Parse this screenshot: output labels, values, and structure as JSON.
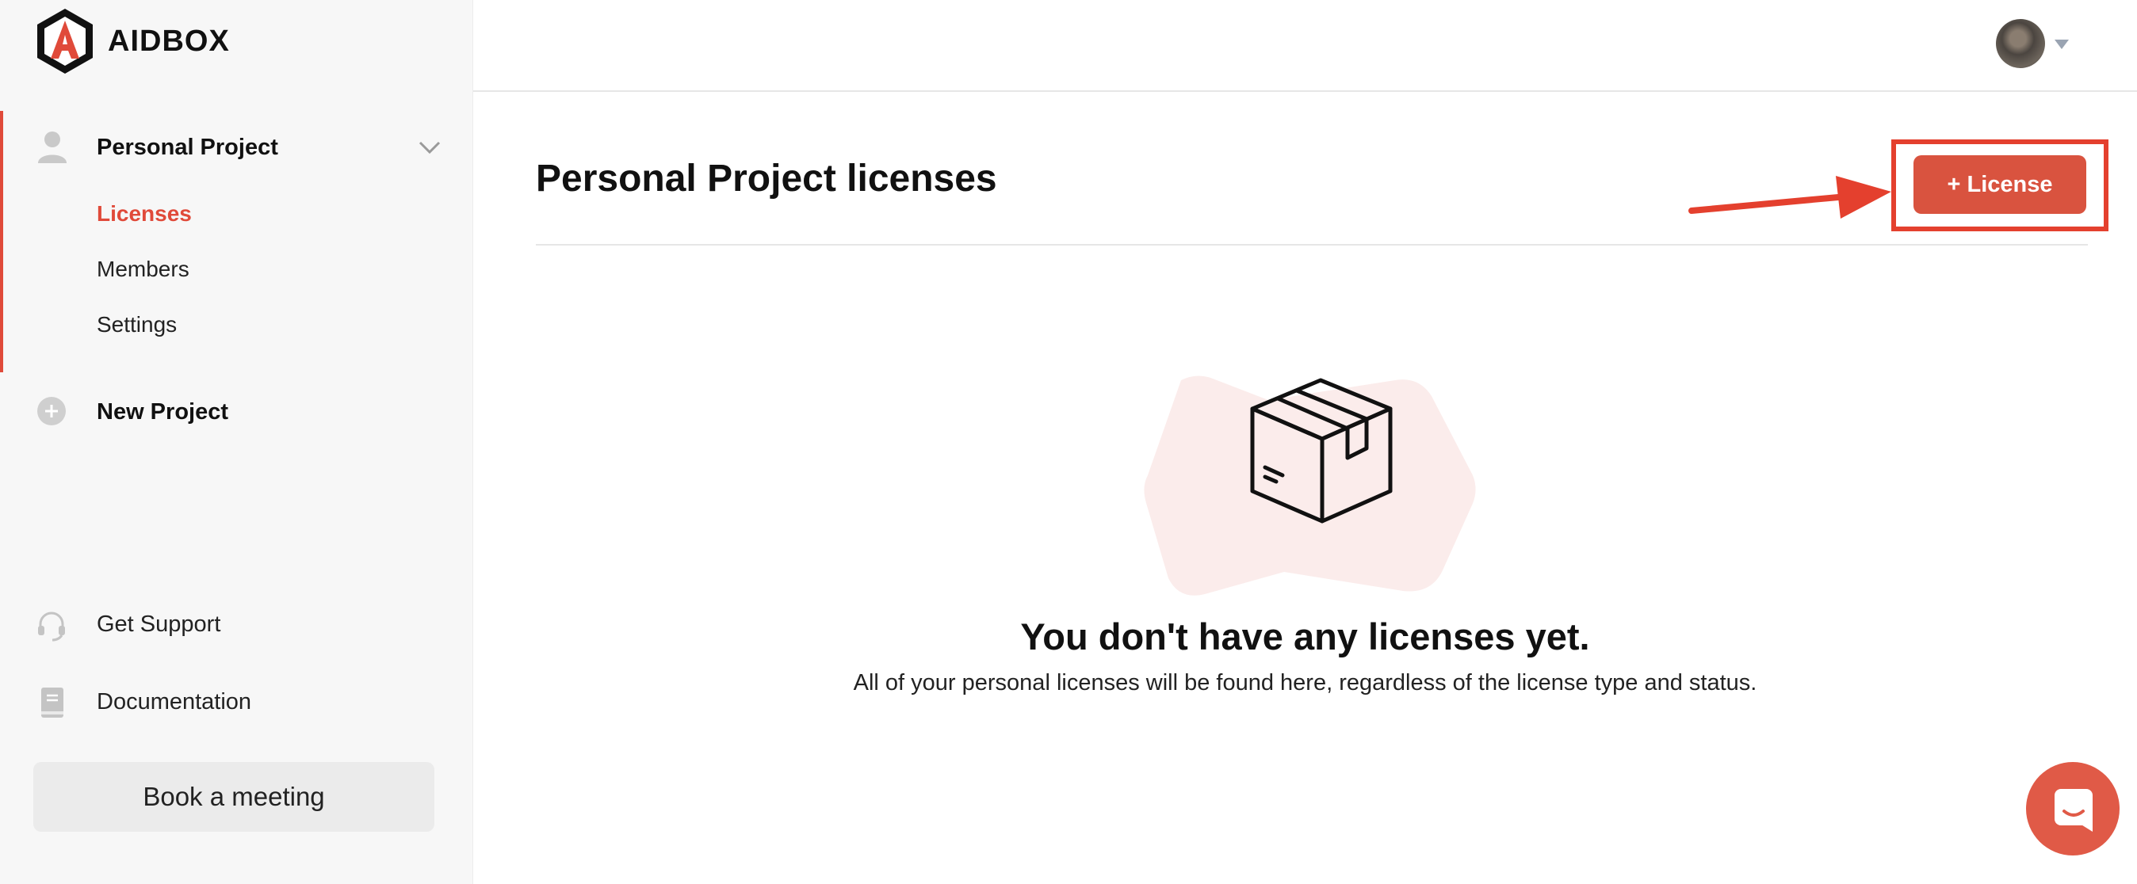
{
  "brand": {
    "name": "AIDBOX"
  },
  "sidebar": {
    "project": {
      "label": "Personal Project"
    },
    "subitems": [
      {
        "label": "Licenses",
        "active": true
      },
      {
        "label": "Members",
        "active": false
      },
      {
        "label": "Settings",
        "active": false
      }
    ],
    "new_project_label": "New Project",
    "support_label": "Get Support",
    "docs_label": "Documentation",
    "meeting_label": "Book a meeting"
  },
  "main": {
    "title": "Personal Project licenses",
    "add_license_label": "+ License",
    "empty": {
      "title": "You don't have any licenses yet.",
      "description": "All of your personal licenses will be found here, regardless of the license type and status."
    }
  },
  "colors": {
    "accent": "#e04a3a",
    "button": "#d9533f",
    "highlight": "#e4402e",
    "illustration_bg": "#fbeceb"
  }
}
